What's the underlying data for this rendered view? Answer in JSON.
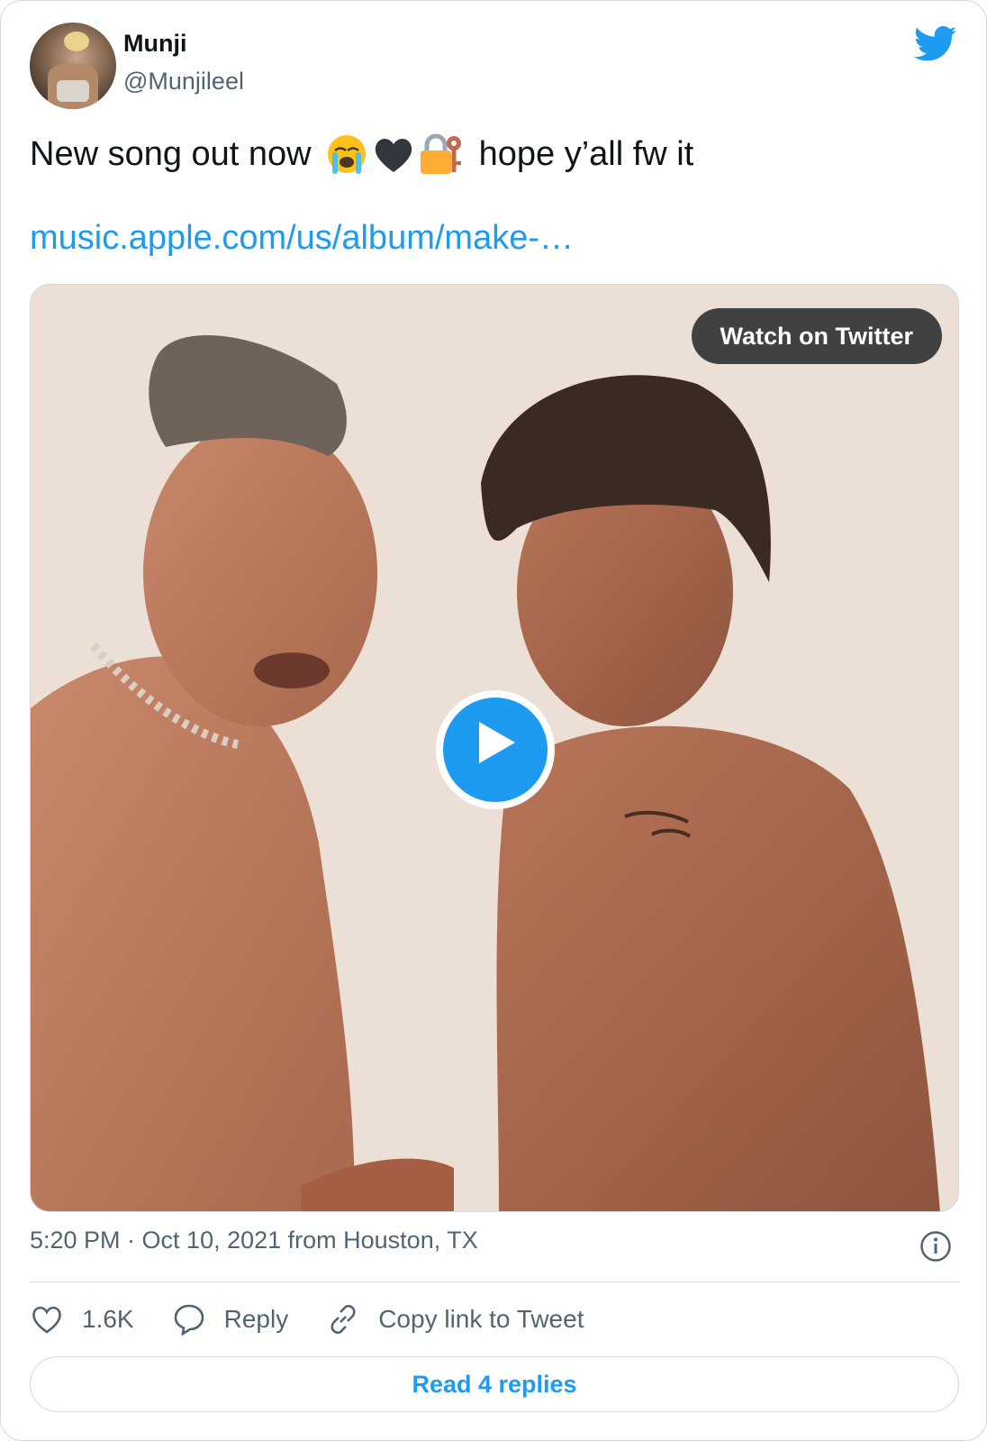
{
  "author": {
    "name": "Munji",
    "handle": "@Munjileel"
  },
  "tweet": {
    "text_before": "New song out now",
    "emojis": [
      "loudly-crying-face",
      "black-heart",
      "locked-with-key"
    ],
    "text_after": "hope y’all fw it",
    "link": "music.apple.com/us/album/make-…"
  },
  "media": {
    "watch_label": "Watch on Twitter",
    "play_icon": "play-icon"
  },
  "meta": {
    "timestamp": "5:20 PM · Oct 10, 2021 from Houston, TX"
  },
  "actions": {
    "likes": "1.6K",
    "reply_label": "Reply",
    "copy_label": "Copy link to Tweet"
  },
  "read_replies_label": "Read 4 replies",
  "colors": {
    "accent": "#1d9bf0",
    "secondary_text": "#536471",
    "border": "#cfd9de"
  }
}
